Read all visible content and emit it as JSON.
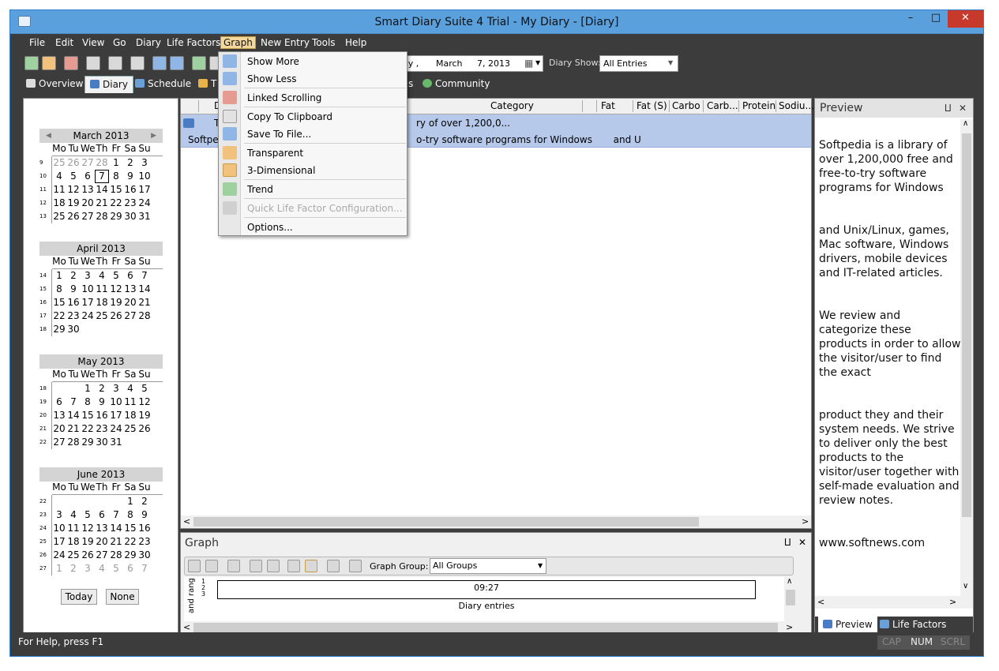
{
  "window": {
    "title": "Smart Diary Suite 4 Trial - My Diary - [Diary]",
    "min": "–",
    "max": "□",
    "close": "✕"
  },
  "menubar": [
    "File",
    "Edit",
    "View",
    "Go",
    "Diary",
    "Life Factors",
    "Graph",
    "New Entry",
    "Tools",
    "Help"
  ],
  "toolbar": {
    "date_day": "ay ,",
    "date_month": "March",
    "date_value": "7, 2013",
    "cal_icon": "▦",
    "dropdown_arrow": "▼",
    "diary_show_label": "Diary Show:",
    "diary_show_value": "All Entries"
  },
  "tabs": {
    "overview": "Overview",
    "diary": "Diary",
    "schedule": "Schedule",
    "partial": "T",
    "partial2": "s",
    "community": "Community"
  },
  "calendar": {
    "dow": [
      "Mo",
      "Tu",
      "We",
      "Th",
      "Fr",
      "Sa",
      "Su"
    ],
    "months": [
      {
        "name": "March 2013",
        "weeks": [
          {
            "wn": "9",
            "days": [
              "25",
              "26",
              "27",
              "28",
              "1",
              "2",
              "3"
            ]
          },
          {
            "wn": "10",
            "days": [
              "4",
              "5",
              "6",
              "7",
              "8",
              "9",
              "10"
            ]
          },
          {
            "wn": "11",
            "days": [
              "11",
              "12",
              "13",
              "14",
              "15",
              "16",
              "17"
            ]
          },
          {
            "wn": "12",
            "days": [
              "18",
              "19",
              "20",
              "21",
              "22",
              "23",
              "24"
            ]
          },
          {
            "wn": "13",
            "days": [
              "25",
              "26",
              "27",
              "28",
              "29",
              "30",
              "31"
            ]
          }
        ]
      },
      {
        "name": "April 2013",
        "weeks": [
          {
            "wn": "14",
            "days": [
              "1",
              "2",
              "3",
              "4",
              "5",
              "6",
              "7"
            ]
          },
          {
            "wn": "15",
            "days": [
              "8",
              "9",
              "10",
              "11",
              "12",
              "13",
              "14"
            ]
          },
          {
            "wn": "16",
            "days": [
              "15",
              "16",
              "17",
              "18",
              "19",
              "20",
              "21"
            ]
          },
          {
            "wn": "17",
            "days": [
              "22",
              "23",
              "24",
              "25",
              "26",
              "27",
              "28"
            ]
          },
          {
            "wn": "18",
            "days": [
              "29",
              "30",
              "",
              "",
              "",
              "",
              ""
            ]
          }
        ]
      },
      {
        "name": "May 2013",
        "weeks": [
          {
            "wn": "18",
            "days": [
              "",
              "",
              "1",
              "2",
              "3",
              "4",
              "5"
            ]
          },
          {
            "wn": "19",
            "days": [
              "6",
              "7",
              "8",
              "9",
              "10",
              "11",
              "12"
            ]
          },
          {
            "wn": "20",
            "days": [
              "13",
              "14",
              "15",
              "16",
              "17",
              "18",
              "19"
            ]
          },
          {
            "wn": "21",
            "days": [
              "20",
              "21",
              "22",
              "23",
              "24",
              "25",
              "26"
            ]
          },
          {
            "wn": "22",
            "days": [
              "27",
              "28",
              "29",
              "30",
              "31",
              "",
              ""
            ]
          }
        ]
      },
      {
        "name": "June 2013",
        "weeks": [
          {
            "wn": "22",
            "days": [
              "",
              "",
              "",
              "",
              "",
              "1",
              "2"
            ]
          },
          {
            "wn": "23",
            "days": [
              "3",
              "4",
              "5",
              "6",
              "7",
              "8",
              "9"
            ]
          },
          {
            "wn": "24",
            "days": [
              "10",
              "11",
              "12",
              "13",
              "14",
              "15",
              "16"
            ]
          },
          {
            "wn": "25",
            "days": [
              "17",
              "18",
              "19",
              "20",
              "21",
              "22",
              "23"
            ]
          },
          {
            "wn": "26",
            "days": [
              "24",
              "25",
              "26",
              "27",
              "28",
              "29",
              "30"
            ]
          },
          {
            "wn": "27",
            "days": [
              "1",
              "2",
              "3",
              "4",
              "5",
              "6",
              "7"
            ]
          }
        ]
      }
    ],
    "today_label": "Today",
    "none_label": "None",
    "prev": "◀",
    "next": "▶"
  },
  "list": {
    "headers": [
      "D",
      "Category",
      "Fat",
      "Fat (S)",
      "Carbo",
      "Carb...",
      "Protein",
      "Sodiu..."
    ],
    "row1_line1_start": "T",
    "row1_line1_end": "ry of over 1,200,0...",
    "row1_line2_start": "Softped",
    "row1_line2_end": "o-try software programs for Windows       and U"
  },
  "graph": {
    "title": "Graph",
    "pin": "⨿",
    "close": "✕",
    "group_label": "Graph Group:",
    "group_value": "All Groups",
    "time": "09:27",
    "xlabel": "Diary entries",
    "ylabel": "and rang",
    "ticks": [
      "1",
      "2",
      "3"
    ]
  },
  "preview": {
    "title": "Preview",
    "paragraphs": [
      "Softpedia is a library of over 1,200,000 free and free-to-try software programs for Windows",
      "and Unix/Linux, games, Mac software, Windows drivers, mobile devices and IT-related articles.",
      "We review and categorize these products in order to allow the visitor/user to find the exact",
      "product they and their system needs. We strive to deliver only the best products to the visitor/user together with self-made evaluation and review notes.",
      "www.softnews.com"
    ],
    "tab_preview": "Preview",
    "tab_life_factors": "Life Factors"
  },
  "graph_menu": {
    "items": [
      "Show More",
      "Show Less",
      "Linked Scrolling",
      "Copy To Clipboard",
      "Save To File...",
      "Transparent",
      "3-Dimensional",
      "Trend",
      "Quick Life Factor Configuration...",
      "Options..."
    ]
  },
  "status": {
    "text": "For Help, press F1",
    "cap": "CAP",
    "num": "NUM",
    "scrl": "SCRL"
  },
  "scroll": {
    "left": "<",
    "right": ">",
    "up": "∧",
    "down": "∨"
  }
}
